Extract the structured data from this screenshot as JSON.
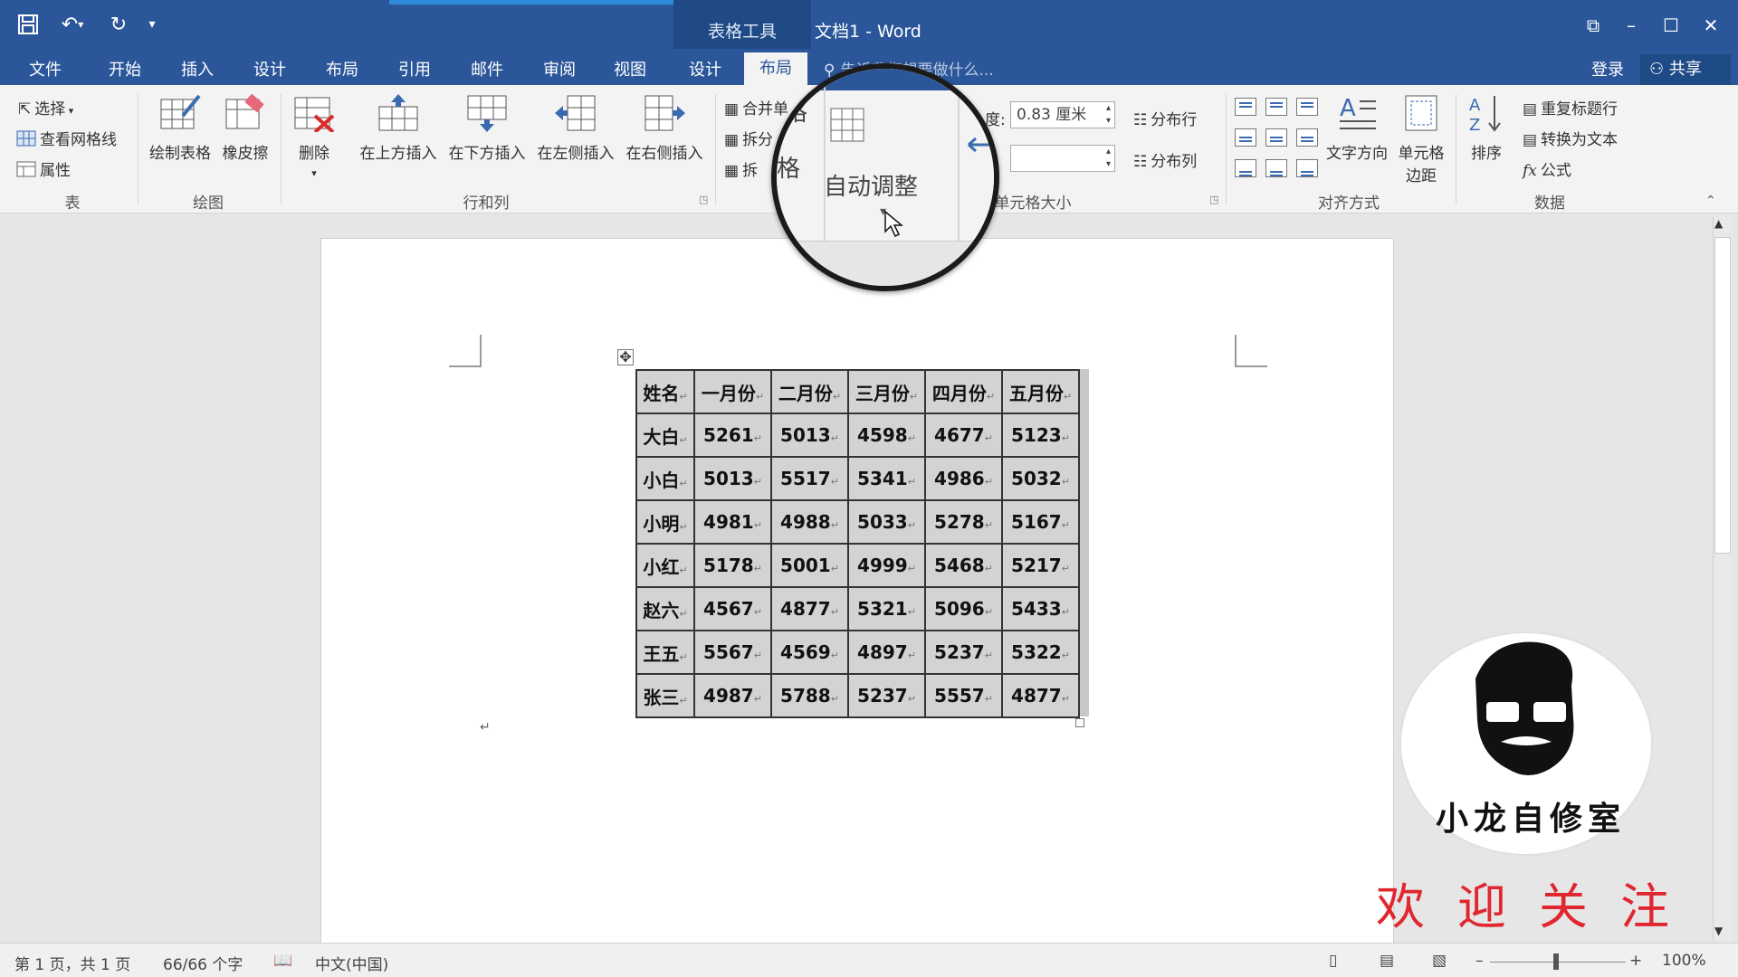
{
  "titlebar": {
    "context_tab_label": "表格工具",
    "doc_title": "文档1 - Word"
  },
  "tabs": [
    {
      "label": "文件"
    },
    {
      "label": "开始"
    },
    {
      "label": "插入"
    },
    {
      "label": "设计"
    },
    {
      "label": "布局"
    },
    {
      "label": "引用"
    },
    {
      "label": "邮件"
    },
    {
      "label": "审阅"
    },
    {
      "label": "视图"
    },
    {
      "label": "设计"
    },
    {
      "label": "布局"
    }
  ],
  "search_placeholder": "告诉我您想要做什么...",
  "account": {
    "login": "登录",
    "share": "共享"
  },
  "ribbon": {
    "table_group": {
      "label": "表",
      "select": "选择",
      "view_gridlines": "查看网格线",
      "properties": "属性"
    },
    "draw_group": {
      "label": "绘图",
      "draw_table": "绘制表格",
      "eraser": "橡皮擦"
    },
    "rows_cols_group": {
      "label": "行和列",
      "delete": "删除",
      "insert_above": "在上方插入",
      "insert_below": "在下方插入",
      "insert_left": "在左侧插入",
      "insert_right": "在右侧插入"
    },
    "merge_group": {
      "merge_cells": "合并单",
      "split_cells": "拆分",
      "split_table": "拆"
    },
    "autofit": {
      "label": "自动调整"
    },
    "cell_size_group": {
      "label": "单元格大小",
      "height_label": "度:",
      "height_value": "0.83 厘米",
      "width_value": "",
      "distribute_rows": "分布行",
      "distribute_cols": "分布列"
    },
    "alignment_group": {
      "label": "对齐方式",
      "text_direction": "文字方向",
      "cell_margins": "单元格边距"
    },
    "data_group": {
      "label": "数据",
      "sort": "排序",
      "repeat_header": "重复标题行",
      "convert_text": "转换为文本",
      "formula": "公式"
    }
  },
  "table": {
    "header": [
      "姓名",
      "一月份",
      "二月份",
      "三月份",
      "四月份",
      "五月份"
    ],
    "rows": [
      [
        "大白",
        "5261",
        "5013",
        "4598",
        "4677",
        "5123"
      ],
      [
        "小白",
        "5013",
        "5517",
        "5341",
        "4986",
        "5032"
      ],
      [
        "小明",
        "4981",
        "4988",
        "5033",
        "5278",
        "5167"
      ],
      [
        "小红",
        "5178",
        "5001",
        "4999",
        "5468",
        "5217"
      ],
      [
        "赵六",
        "4567",
        "4877",
        "5321",
        "5096",
        "5433"
      ],
      [
        "王五",
        "5567",
        "4569",
        "4897",
        "5237",
        "5322"
      ],
      [
        "张三",
        "4987",
        "5788",
        "5237",
        "5557",
        "4877"
      ]
    ],
    "cell_mark": "↵",
    "paragraph_mark": "↵"
  },
  "statusbar": {
    "page": "第 1 页，共 1 页",
    "words": "66/66 个字",
    "language": "中文(中国)",
    "zoom": "100%"
  },
  "watermark": {
    "logo_text": "小龙自修室",
    "welcome": "欢迎关注"
  },
  "colors": {
    "brand": "#2b579a",
    "context_band": "#1f4a86",
    "welcome_red": "#e0262f"
  }
}
